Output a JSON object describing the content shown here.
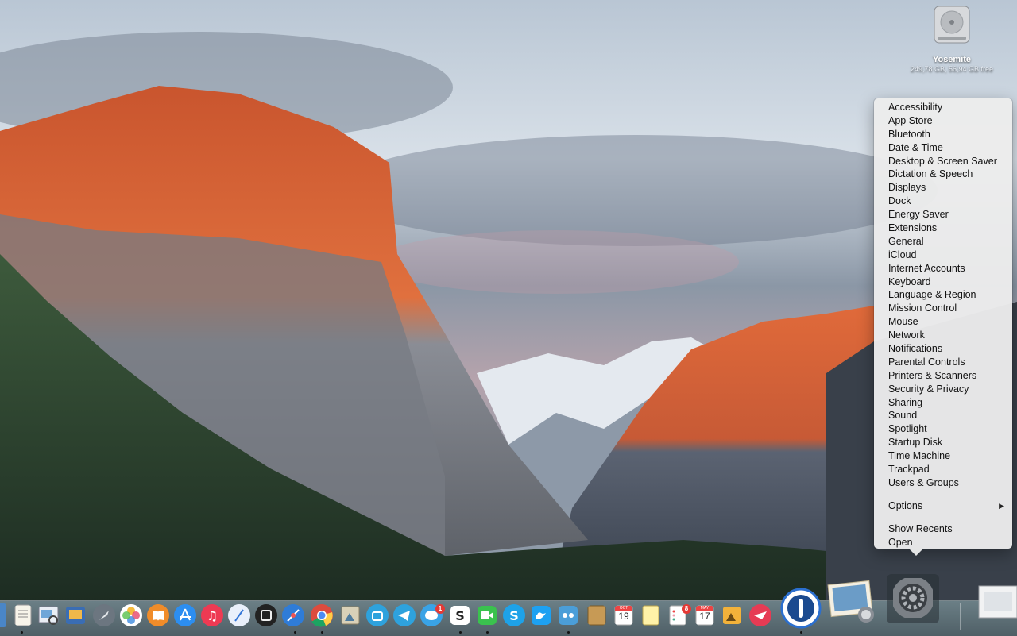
{
  "desktop": {
    "drive": {
      "name": "Yosemite",
      "info": "249,78 GB, 56,94 GB free"
    }
  },
  "menu": {
    "items": [
      "Accessibility",
      "App Store",
      "Bluetooth",
      "Date & Time",
      "Desktop & Screen Saver",
      "Dictation & Speech",
      "Displays",
      "Dock",
      "Energy Saver",
      "Extensions",
      "General",
      "iCloud",
      "Internet Accounts",
      "Keyboard",
      "Language & Region",
      "Mission Control",
      "Mouse",
      "Network",
      "Notifications",
      "Parental Controls",
      "Printers & Scanners",
      "Security & Privacy",
      "Sharing",
      "Sound",
      "Spotlight",
      "Startup Disk",
      "Time Machine",
      "Trackpad",
      "Users & Groups"
    ],
    "options_label": "Options",
    "options_arrow": "▶",
    "show_recents": "Show Recents",
    "open": "Open"
  },
  "dock": {
    "badges": {
      "messages": "1",
      "reminders": "8"
    },
    "calendar_small": {
      "month": "OCT",
      "day": "19"
    },
    "calendar": {
      "month": "MAY",
      "day": "17"
    },
    "icons": [
      "finder-icon",
      "textedit-icon",
      "preview-icon",
      "photo-booth-icon",
      "launchpad-icon",
      "photos-icon",
      "ibooks-icon",
      "app-store-icon",
      "itunes-icon",
      "safari-icon",
      "chrome-icon",
      "mission-control-icon",
      "sketch-icon",
      "telegram-icon",
      "speech-bubbles-icon",
      "slack-icon",
      "facetime-icon",
      "skype-icon",
      "twitter-icon",
      "tweetbot-icon",
      "notefile-icon",
      "calendar-icon",
      "notes-icon",
      "reminders-icon",
      "ical-icon",
      "image-icon",
      "airmail-icon",
      "1password-icon",
      "iphoto-icon",
      "system-preferences-icon",
      "trash-icon"
    ]
  }
}
